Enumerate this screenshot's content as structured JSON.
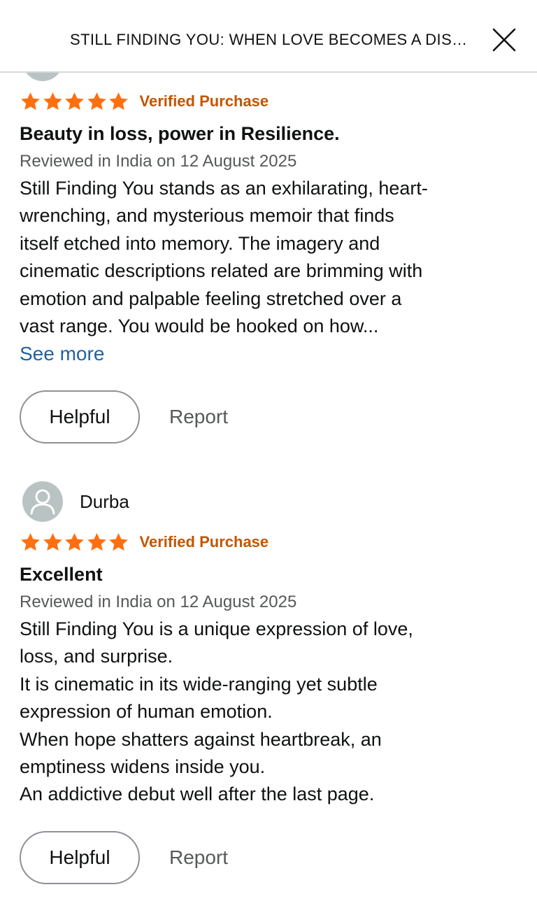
{
  "header": {
    "title": "STILL FINDING YOU: WHEN LOVE BECOMES A DISE..."
  },
  "reviews": [
    {
      "reviewer": "",
      "rating": 5,
      "verified_label": "Verified Purchase",
      "title": "Beauty in loss, power in Resilience.",
      "date": "Reviewed in India on 12 August 2025",
      "body_lines": [
        "Still Finding You stands as an exhilarating, heart-",
        "wrenching, and mysterious memoir that finds",
        "itself etched into memory. The imagery and",
        "cinematic descriptions related are brimming with",
        "emotion and palpable feeling stretched over a",
        "vast range. You would be hooked on how..."
      ],
      "see_more_label": "See more",
      "helpful_label": "Helpful",
      "report_label": "Report"
    },
    {
      "reviewer": "Durba",
      "rating": 5,
      "verified_label": "Verified Purchase",
      "title": "Excellent",
      "date": "Reviewed in India on 12 August 2025",
      "body_lines": [
        "Still Finding You is a unique expression of love,",
        "loss, and surprise.",
        "It is cinematic in its wide-ranging yet subtle",
        "expression of human emotion.",
        "When hope shatters against heartbreak, an",
        "emptiness widens inside you.",
        "An addictive debut well after the last page."
      ],
      "helpful_label": "Helpful",
      "report_label": "Report"
    }
  ],
  "icons": {
    "close": "close-icon",
    "star": "star-icon",
    "avatar": "user-avatar-icon"
  },
  "colors": {
    "star": "#ff6f0f",
    "verified": "#c45500",
    "link": "#2162a1",
    "secondary_text": "#565959",
    "avatar_bg": "#b9c3c3"
  }
}
